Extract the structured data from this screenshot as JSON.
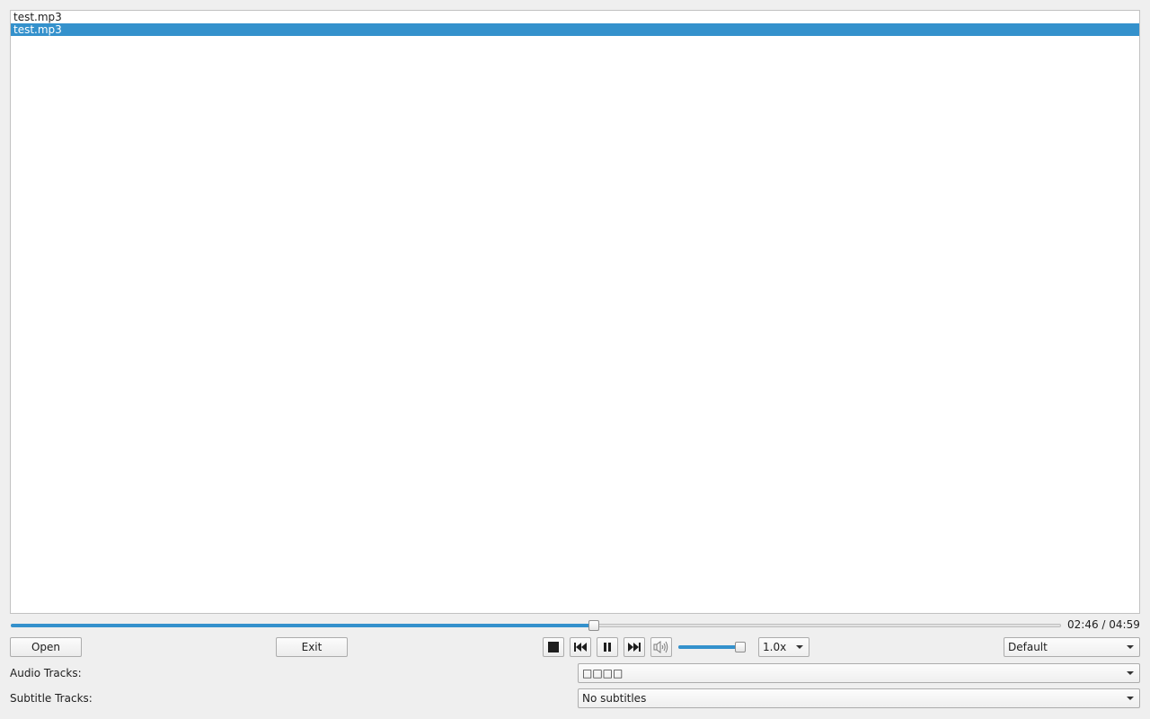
{
  "playlist": {
    "items": [
      {
        "label": "test.mp3",
        "selected": false
      },
      {
        "label": "test.mp3",
        "selected": true
      }
    ]
  },
  "playback": {
    "position_fraction": 0.555,
    "time_label": "02:46 / 04:59"
  },
  "controls": {
    "open_label": "Open",
    "exit_label": "Exit",
    "stop_icon": "stop-icon",
    "previous_icon": "skip-back-icon",
    "pause_icon": "pause-icon",
    "next_icon": "skip-forward-icon",
    "mute_icon": "volume-icon",
    "volume_fraction": 0.9,
    "speed_value": "1.0x",
    "mode_value": "Default"
  },
  "tracks": {
    "audio_label": "Audio Tracks:",
    "audio_value": "□□□□",
    "subtitle_label": "Subtitle Tracks:",
    "subtitle_value": "No subtitles"
  },
  "colors": {
    "accent": "#3491cc",
    "background": "#efefef"
  }
}
